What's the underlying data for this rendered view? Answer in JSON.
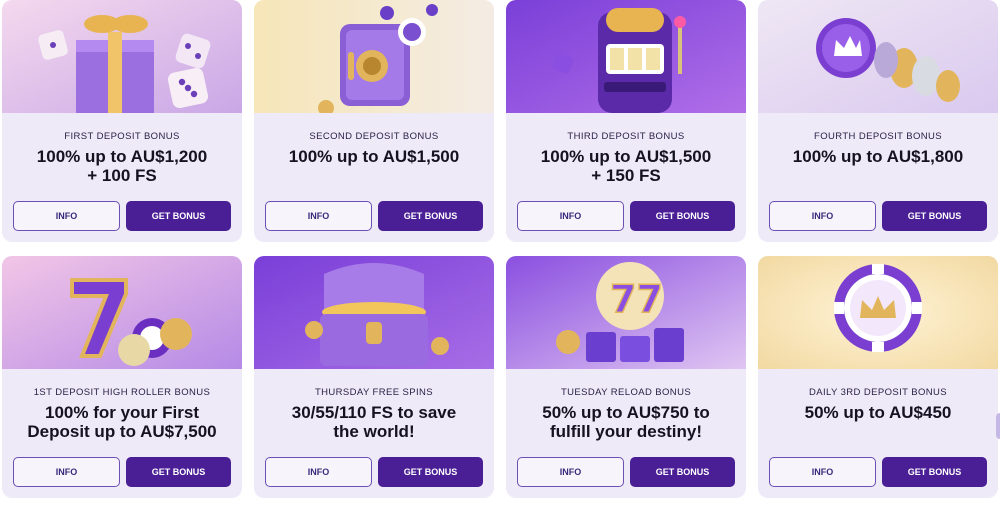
{
  "promos": [
    {
      "subtitle": "FIRST DEPOSIT BONUS",
      "title": "100% up to AU$1,200\n+ 100 FS",
      "info_label": "INFO",
      "cta_label": "GET BONUS",
      "image": "gift-box-with-dice"
    },
    {
      "subtitle": "SECOND DEPOSIT BONUS",
      "title": "100% up to AU$1,500",
      "info_label": "INFO",
      "cta_label": "GET BONUS",
      "image": "safe-with-chips"
    },
    {
      "subtitle": "THIRD DEPOSIT BONUS",
      "title": "100% up to AU$1,500\n+ 150 FS",
      "info_label": "INFO",
      "cta_label": "GET BONUS",
      "image": "slot-machine"
    },
    {
      "subtitle": "FOURTH DEPOSIT BONUS",
      "title": "100% up to AU$1,800",
      "info_label": "INFO",
      "cta_label": "GET BONUS",
      "image": "crown-token-with-coins"
    },
    {
      "subtitle": "1ST DEPOSIT HIGH ROLLER BONUS",
      "title": "100% for your First\nDeposit up to AU$7,500",
      "info_label": "INFO",
      "cta_label": "GET BONUS",
      "image": "lucky-seven-with-chips"
    },
    {
      "subtitle": "THURSDAY FREE SPINS",
      "title": "30/55/110 FS to save\nthe world!",
      "info_label": "INFO",
      "cta_label": "GET BONUS",
      "image": "treasure-chest"
    },
    {
      "subtitle": "TUESDAY RELOAD BONUS",
      "title": "50% up to AU$750 to\nfulfill your destiny!",
      "info_label": "INFO",
      "cta_label": "GET BONUS",
      "image": "triple-seven-with-chip-stacks"
    },
    {
      "subtitle": "DAILY 3RD DEPOSIT BONUS",
      "title": "50% up to AU$450",
      "info_label": "INFO",
      "cta_label": "GET BONUS",
      "image": "crown-poker-chip"
    }
  ],
  "colors": {
    "card_bg": "#efeaf7",
    "cta_bg": "#4a1f96",
    "info_border": "#6b4fb3",
    "title": "#151322"
  }
}
